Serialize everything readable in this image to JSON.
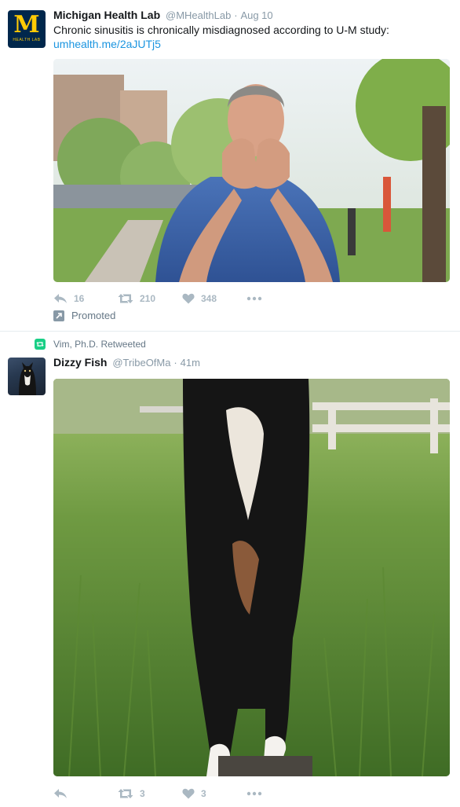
{
  "tweets": [
    {
      "avatar": {
        "letter": "M",
        "subtext": "HEALTH LAB",
        "bg": "#00274c",
        "fg": "#ffcb05"
      },
      "display_name": "Michigan Health Lab",
      "handle": "@MHealthLab",
      "separator": "·",
      "time": "Aug 10",
      "text": "Chronic sinusitis is chronically misdiagnosed according to U-M study:",
      "link": "umhealth.me/2aJUTj5",
      "media_icon": "man-holding-nose-photo",
      "actions": {
        "replies": "16",
        "retweets": "210",
        "likes": "348"
      },
      "promoted_label": "Promoted"
    },
    {
      "retweet_context": "Vim, Ph.D. Retweeted",
      "avatar": {
        "icon": "cat-avatar"
      },
      "display_name": "Dizzy Fish",
      "handle": "@TribeOfMa",
      "separator": "·",
      "time": "41m",
      "media_icon": "standing-cat-photo",
      "actions": {
        "replies": "",
        "retweets": "3",
        "likes": "3"
      }
    }
  ],
  "colors": {
    "link": "#1b95e0",
    "muted": "#8899a6",
    "action_icon": "#aab8c2",
    "retweet_badge": "#19cf86"
  }
}
